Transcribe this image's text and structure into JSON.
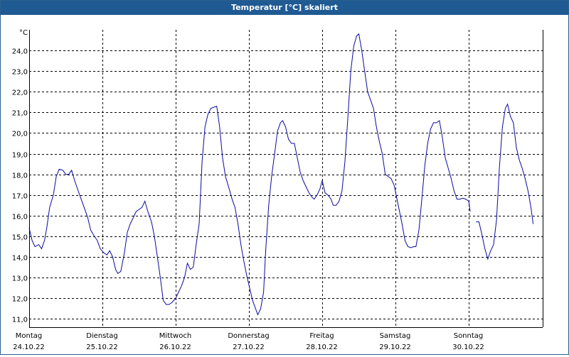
{
  "window": {
    "title": "Temperatur [°C] skaliert"
  },
  "chart_data": {
    "type": "line",
    "title": "Temperatur [°C] skaliert",
    "unit_label": "°C",
    "ylim": [
      10.6,
      25.0
    ],
    "yticks": [
      11.0,
      12.0,
      13.0,
      14.0,
      15.0,
      16.0,
      17.0,
      18.0,
      19.0,
      20.0,
      21.0,
      22.0,
      23.0,
      24.0
    ],
    "ytick_labels": [
      "11,0",
      "12,0",
      "13,0",
      "14,0",
      "15,0",
      "16,0",
      "17,0",
      "18,0",
      "19,0",
      "20,0",
      "21,0",
      "22,0",
      "23,0",
      "24,0"
    ],
    "xlim": [
      0,
      7.0
    ],
    "grid": true,
    "color": "#0a0aa0",
    "days": [
      {
        "x": 0,
        "weekday": "Montag",
        "date": "24.10.22"
      },
      {
        "x": 1,
        "weekday": "Dienstag",
        "date": "25.10.22"
      },
      {
        "x": 2,
        "weekday": "Mittwoch",
        "date": "26.10.22"
      },
      {
        "x": 3,
        "weekday": "Donnerstag",
        "date": "27.10.22"
      },
      {
        "x": 4,
        "weekday": "Freitag",
        "date": "28.10.22"
      },
      {
        "x": 5,
        "weekday": "Samstag",
        "date": "29.10.22"
      },
      {
        "x": 6,
        "weekday": "Sonntag",
        "date": "30.10.22"
      }
    ],
    "series": [
      {
        "segments": [
          [
            [
              0.0,
              15.4
            ],
            [
              0.04,
              14.8
            ],
            [
              0.08,
              14.5
            ],
            [
              0.13,
              14.6
            ],
            [
              0.17,
              14.4
            ],
            [
              0.21,
              14.8
            ],
            [
              0.24,
              15.4
            ],
            [
              0.28,
              16.4
            ],
            [
              0.33,
              17.0
            ],
            [
              0.37,
              17.9
            ],
            [
              0.41,
              18.25
            ],
            [
              0.46,
              18.2
            ],
            [
              0.5,
              18.0
            ],
            [
              0.54,
              18.0
            ],
            [
              0.58,
              18.2
            ],
            [
              0.62,
              17.7
            ],
            [
              0.67,
              17.2
            ],
            [
              0.71,
              16.8
            ],
            [
              0.75,
              16.4
            ],
            [
              0.8,
              15.9
            ],
            [
              0.84,
              15.3
            ],
            [
              0.89,
              15.0
            ],
            [
              0.93,
              14.8
            ],
            [
              0.97,
              14.4
            ],
            [
              1.02,
              14.2
            ],
            [
              1.06,
              14.1
            ],
            [
              1.1,
              14.3
            ],
            [
              1.14,
              14.0
            ],
            [
              1.18,
              13.4
            ],
            [
              1.21,
              13.2
            ],
            [
              1.25,
              13.3
            ],
            [
              1.3,
              14.2
            ],
            [
              1.34,
              15.2
            ],
            [
              1.38,
              15.6
            ],
            [
              1.42,
              15.9
            ],
            [
              1.46,
              16.2
            ],
            [
              1.5,
              16.3
            ],
            [
              1.54,
              16.4
            ],
            [
              1.58,
              16.7
            ],
            [
              1.62,
              16.2
            ],
            [
              1.67,
              15.7
            ],
            [
              1.71,
              15.0
            ],
            [
              1.75,
              14.0
            ],
            [
              1.79,
              13.0
            ],
            [
              1.83,
              11.9
            ],
            [
              1.87,
              11.7
            ],
            [
              1.91,
              11.7
            ],
            [
              1.95,
              11.8
            ],
            [
              2.0,
              12.0
            ],
            [
              2.04,
              12.3
            ],
            [
              2.08,
              12.6
            ],
            [
              2.12,
              13.0
            ],
            [
              2.16,
              13.7
            ],
            [
              2.2,
              13.4
            ],
            [
              2.24,
              13.5
            ],
            [
              2.28,
              14.6
            ],
            [
              2.32,
              15.6
            ],
            [
              2.36,
              18.6
            ],
            [
              2.4,
              20.3
            ],
            [
              2.44,
              20.9
            ],
            [
              2.48,
              21.2
            ],
            [
              2.52,
              21.25
            ],
            [
              2.56,
              21.3
            ],
            [
              2.6,
              20.3
            ],
            [
              2.64,
              18.8
            ],
            [
              2.68,
              17.9
            ],
            [
              2.73,
              17.3
            ],
            [
              2.77,
              16.8
            ],
            [
              2.81,
              16.4
            ],
            [
              2.85,
              15.6
            ],
            [
              2.89,
              14.6
            ],
            [
              2.93,
              13.8
            ],
            [
              2.97,
              13.1
            ],
            [
              3.01,
              12.5
            ],
            [
              3.05,
              11.9
            ],
            [
              3.09,
              11.5
            ],
            [
              3.12,
              11.2
            ],
            [
              3.16,
              11.5
            ],
            [
              3.2,
              12.3
            ],
            [
              3.23,
              14.4
            ],
            [
              3.27,
              16.5
            ],
            [
              3.31,
              17.9
            ],
            [
              3.35,
              19.0
            ],
            [
              3.39,
              20.1
            ],
            [
              3.43,
              20.5
            ],
            [
              3.46,
              20.6
            ],
            [
              3.5,
              20.3
            ],
            [
              3.54,
              19.7
            ],
            [
              3.58,
              19.5
            ],
            [
              3.62,
              19.5
            ],
            [
              3.66,
              18.8
            ],
            [
              3.7,
              18.1
            ],
            [
              3.74,
              17.7
            ],
            [
              3.78,
              17.4
            ],
            [
              3.82,
              17.1
            ],
            [
              3.86,
              16.9
            ],
            [
              3.89,
              16.8
            ],
            [
              3.93,
              17.0
            ],
            [
              3.97,
              17.3
            ],
            [
              4.0,
              17.7
            ],
            [
              4.04,
              17.1
            ],
            [
              4.08,
              17.0
            ],
            [
              4.12,
              16.8
            ],
            [
              4.15,
              16.5
            ],
            [
              4.19,
              16.5
            ],
            [
              4.23,
              16.7
            ],
            [
              4.27,
              17.2
            ],
            [
              4.31,
              18.6
            ],
            [
              4.35,
              20.7
            ],
            [
              4.39,
              23.0
            ],
            [
              4.43,
              24.2
            ],
            [
              4.47,
              24.7
            ],
            [
              4.5,
              24.8
            ],
            [
              4.54,
              24.0
            ],
            [
              4.58,
              23.0
            ],
            [
              4.62,
              22.0
            ],
            [
              4.66,
              21.6
            ],
            [
              4.7,
              21.2
            ],
            [
              4.74,
              20.3
            ],
            [
              4.78,
              19.6
            ],
            [
              4.82,
              19.0
            ],
            [
              4.86,
              18.0
            ],
            [
              4.9,
              17.9
            ],
            [
              4.94,
              17.8
            ],
            [
              4.98,
              17.5
            ],
            [
              5.01,
              17.0
            ],
            [
              5.05,
              16.3
            ],
            [
              5.09,
              15.6
            ],
            [
              5.13,
              14.8
            ],
            [
              5.17,
              14.5
            ],
            [
              5.21,
              14.45
            ],
            [
              5.25,
              14.5
            ],
            [
              5.28,
              14.5
            ],
            [
              5.32,
              15.3
            ],
            [
              5.36,
              16.8
            ],
            [
              5.4,
              18.4
            ],
            [
              5.44,
              19.5
            ],
            [
              5.48,
              20.2
            ],
            [
              5.52,
              20.5
            ],
            [
              5.56,
              20.5
            ],
            [
              5.6,
              20.6
            ],
            [
              5.64,
              19.8
            ],
            [
              5.68,
              18.8
            ],
            [
              5.72,
              18.3
            ],
            [
              5.76,
              17.8
            ],
            [
              5.8,
              17.2
            ],
            [
              5.84,
              16.8
            ],
            [
              5.88,
              16.8
            ],
            [
              5.92,
              16.85
            ],
            [
              5.96,
              16.8
            ],
            [
              6.0,
              16.7
            ],
            [
              6.02,
              16.2
            ]
          ],
          [
            [
              6.1,
              15.7
            ],
            [
              6.14,
              15.7
            ],
            [
              6.18,
              15.1
            ],
            [
              6.22,
              14.4
            ],
            [
              6.26,
              13.9
            ],
            [
              6.3,
              14.3
            ],
            [
              6.34,
              14.6
            ],
            [
              6.38,
              15.8
            ],
            [
              6.42,
              18.4
            ],
            [
              6.46,
              20.3
            ],
            [
              6.5,
              21.2
            ],
            [
              6.53,
              21.4
            ],
            [
              6.57,
              20.8
            ],
            [
              6.61,
              20.5
            ],
            [
              6.65,
              19.3
            ],
            [
              6.69,
              18.7
            ],
            [
              6.73,
              18.3
            ],
            [
              6.77,
              17.8
            ],
            [
              6.81,
              17.2
            ],
            [
              6.85,
              16.4
            ],
            [
              6.88,
              15.6
            ]
          ]
        ]
      }
    ]
  }
}
